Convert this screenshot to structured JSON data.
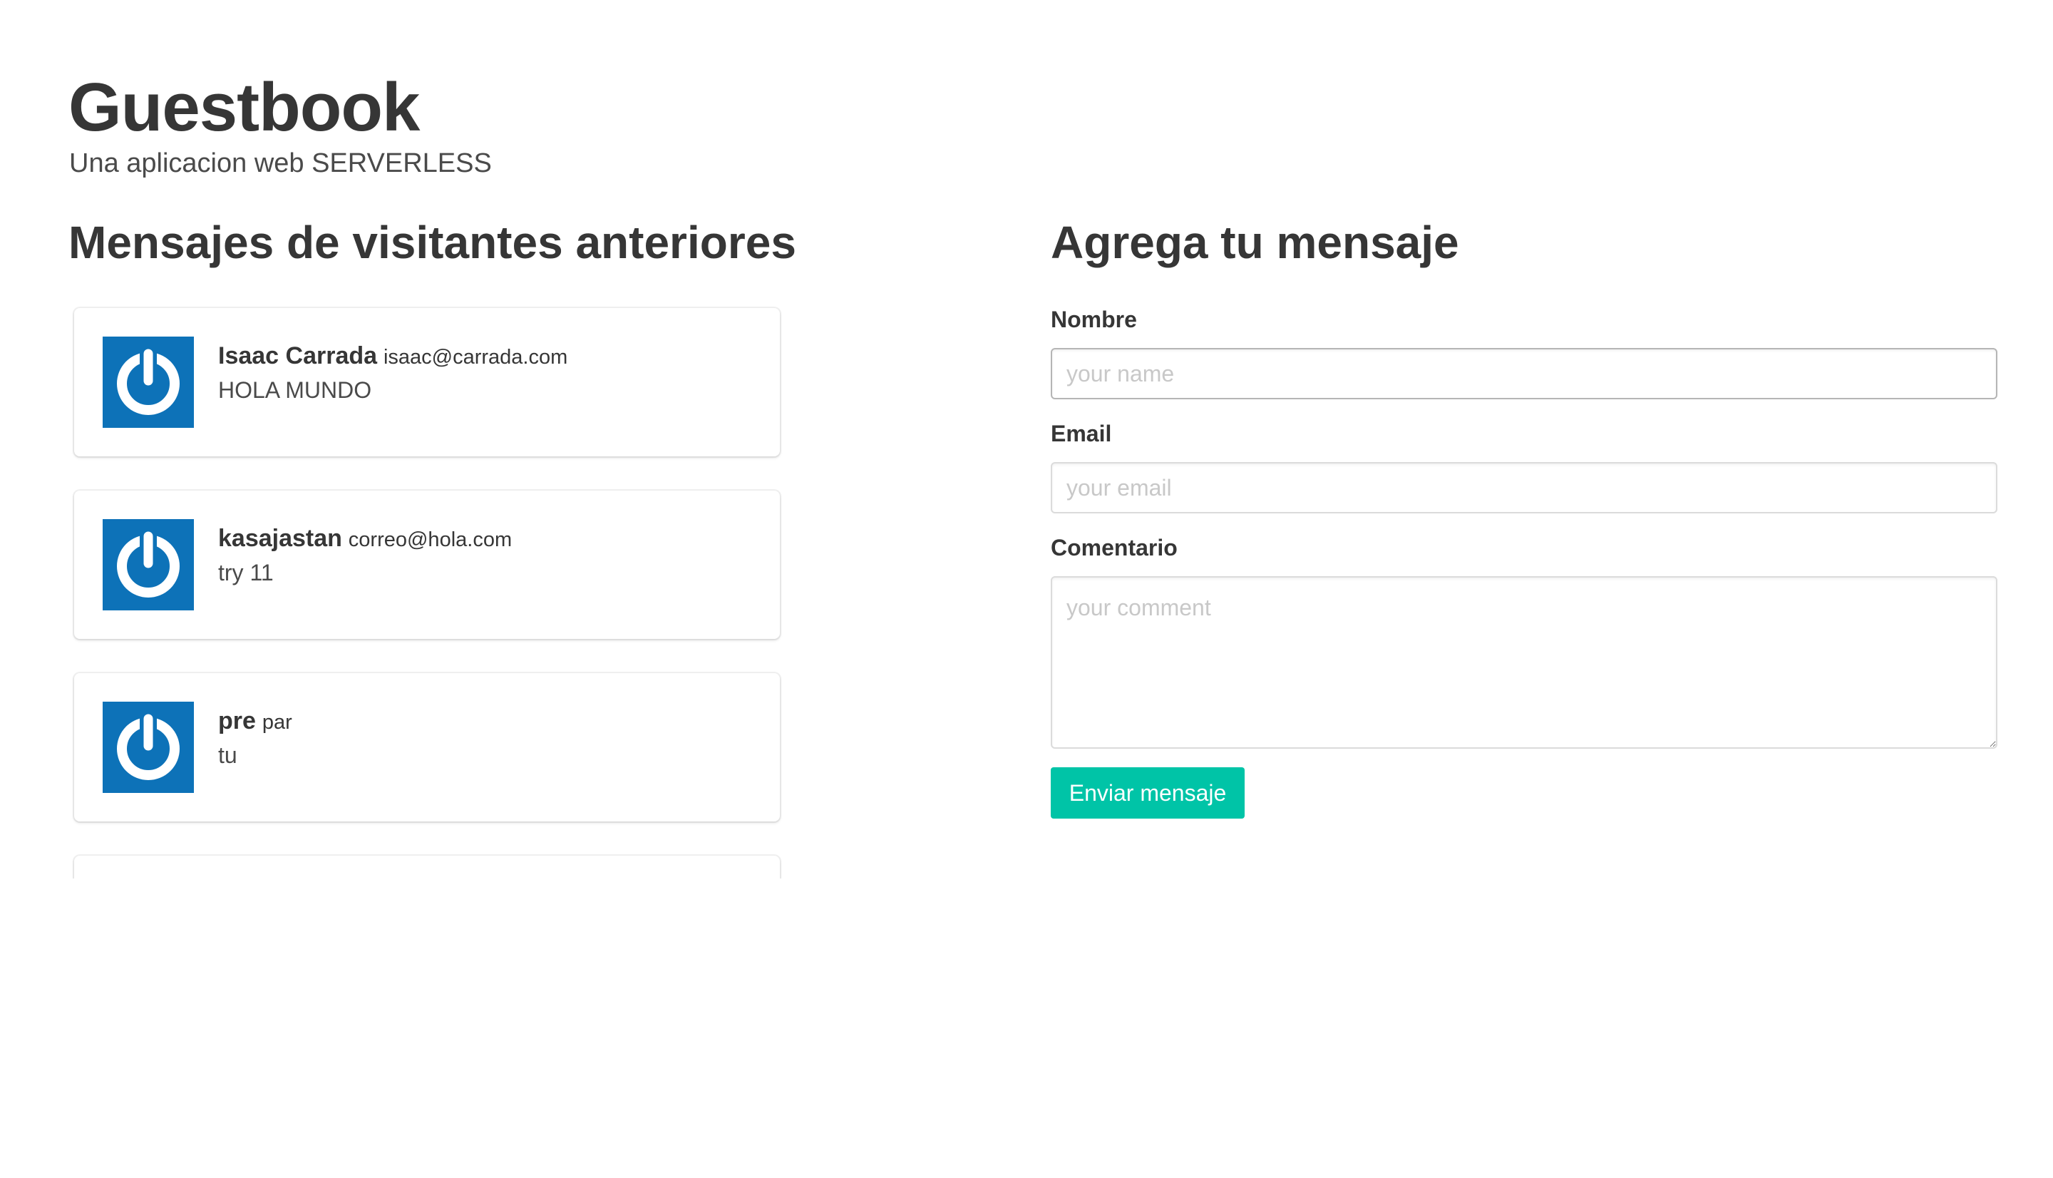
{
  "header": {
    "title": "Guestbook",
    "subtitle": "Una aplicacion web SERVERLESS"
  },
  "messages_section": {
    "heading": "Mensajes de visitantes anteriores",
    "messages": [
      {
        "name": "Isaac Carrada",
        "email": "isaac@carrada.com",
        "text": "HOLA MUNDO"
      },
      {
        "name": "kasajastan",
        "email": "correo@hola.com",
        "text": "try 11"
      },
      {
        "name": "pre",
        "email": "par",
        "text": "tu"
      }
    ],
    "avatar_icon": "power-icon",
    "avatar_color": "#0d72b8"
  },
  "form": {
    "heading": "Agrega tu mensaje",
    "name_label": "Nombre",
    "name_placeholder": "your name",
    "name_value": "",
    "email_label": "Email",
    "email_placeholder": "your email",
    "email_value": "",
    "comment_label": "Comentario",
    "comment_placeholder": "your comment",
    "comment_value": "",
    "submit_label": "Enviar mensaje",
    "submit_color": "#00c4a7"
  }
}
